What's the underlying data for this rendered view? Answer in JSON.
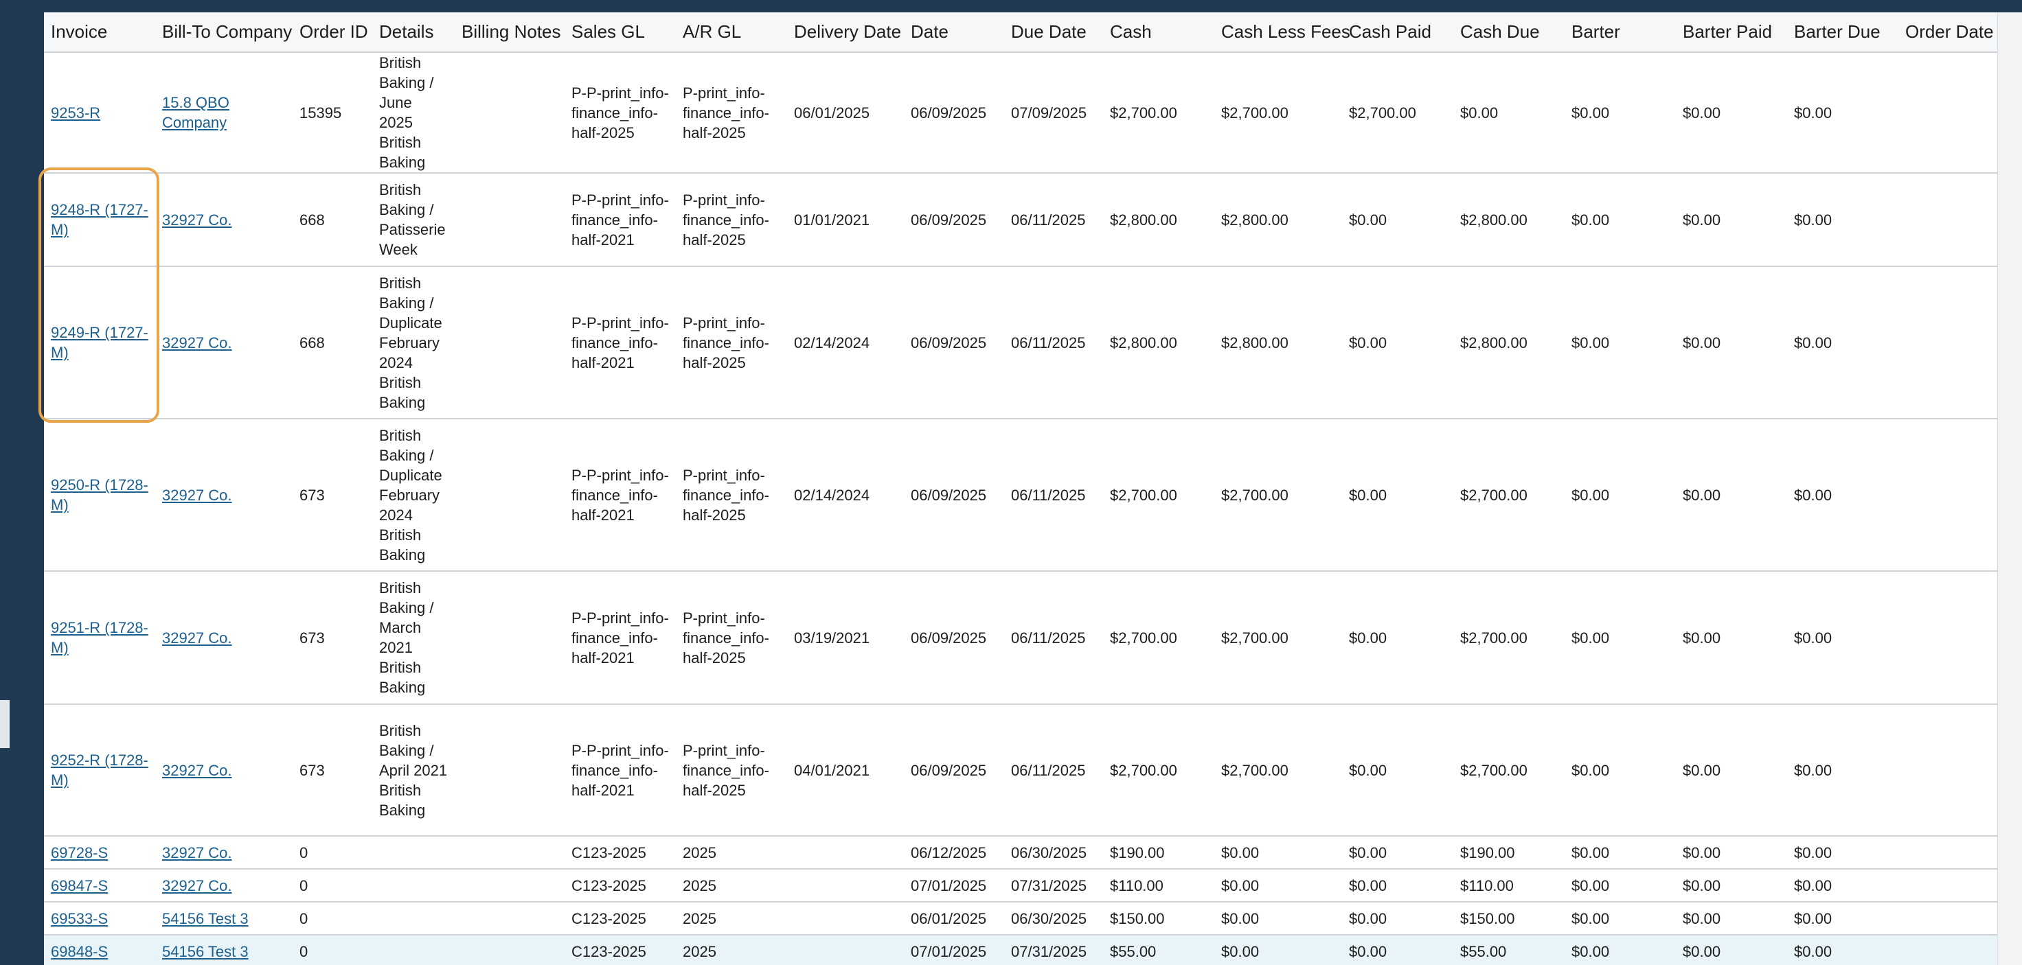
{
  "columns": [
    {
      "key": "invoice",
      "label": "Invoice"
    },
    {
      "key": "bill_to",
      "label": "Bill-To Company"
    },
    {
      "key": "order_id",
      "label": "Order ID"
    },
    {
      "key": "details",
      "label": "Details"
    },
    {
      "key": "billing_notes",
      "label": "Billing Notes"
    },
    {
      "key": "sales_gl",
      "label": "Sales GL"
    },
    {
      "key": "ar_gl",
      "label": "A/R GL"
    },
    {
      "key": "delivery_date",
      "label": "Delivery Date"
    },
    {
      "key": "date",
      "label": "Date"
    },
    {
      "key": "due_date",
      "label": "Due Date"
    },
    {
      "key": "cash",
      "label": "Cash"
    },
    {
      "key": "cash_less_fees",
      "label": "Cash Less Fees"
    },
    {
      "key": "cash_paid",
      "label": "Cash Paid"
    },
    {
      "key": "cash_due",
      "label": "Cash Due"
    },
    {
      "key": "barter",
      "label": "Barter"
    },
    {
      "key": "barter_paid",
      "label": "Barter Paid"
    },
    {
      "key": "barter_due",
      "label": "Barter Due"
    },
    {
      "key": "order_date",
      "label": "Order Date"
    }
  ],
  "rows": [
    {
      "invoice": "9253-R",
      "bill_to": "15.8 QBO Company",
      "order_id": "15395",
      "details": "British Baking / June 2025 British Baking",
      "billing_notes": "",
      "sales_gl": "P-P-print_info-finance_info-half-2025",
      "ar_gl": "P-print_info-finance_info-half-2025",
      "delivery_date": "06/01/2025",
      "date": "06/09/2025",
      "due_date": "07/09/2025",
      "cash": "$2,700.00",
      "cash_less_fees": "$2,700.00",
      "cash_paid": "$2,700.00",
      "cash_due": "$0.00",
      "barter": "$0.00",
      "barter_paid": "$0.00",
      "barter_due": "$0.00",
      "order_date": ""
    },
    {
      "invoice": "9248-R (1727-M)",
      "bill_to": "32927 Co.",
      "order_id": "668",
      "details": "British Baking / Patisserie Week",
      "billing_notes": "",
      "sales_gl": "P-P-print_info-finance_info-half-2021",
      "ar_gl": "P-print_info-finance_info-half-2025",
      "delivery_date": "01/01/2021",
      "date": "06/09/2025",
      "due_date": "06/11/2025",
      "cash": "$2,800.00",
      "cash_less_fees": "$2,800.00",
      "cash_paid": "$0.00",
      "cash_due": "$2,800.00",
      "barter": "$0.00",
      "barter_paid": "$0.00",
      "barter_due": "$0.00",
      "order_date": ""
    },
    {
      "invoice": "9249-R (1727-M)",
      "bill_to": "32927 Co.",
      "order_id": "668",
      "details": "British Baking / Duplicate February 2024 British Baking",
      "billing_notes": "",
      "sales_gl": "P-P-print_info-finance_info-half-2021",
      "ar_gl": "P-print_info-finance_info-half-2025",
      "delivery_date": "02/14/2024",
      "date": "06/09/2025",
      "due_date": "06/11/2025",
      "cash": "$2,800.00",
      "cash_less_fees": "$2,800.00",
      "cash_paid": "$0.00",
      "cash_due": "$2,800.00",
      "barter": "$0.00",
      "barter_paid": "$0.00",
      "barter_due": "$0.00",
      "order_date": ""
    },
    {
      "invoice": "9250-R (1728-M)",
      "bill_to": "32927 Co.",
      "order_id": "673",
      "details": "British Baking / Duplicate February 2024 British Baking",
      "billing_notes": "",
      "sales_gl": "P-P-print_info-finance_info-half-2021",
      "ar_gl": "P-print_info-finance_info-half-2025",
      "delivery_date": "02/14/2024",
      "date": "06/09/2025",
      "due_date": "06/11/2025",
      "cash": "$2,700.00",
      "cash_less_fees": "$2,700.00",
      "cash_paid": "$0.00",
      "cash_due": "$2,700.00",
      "barter": "$0.00",
      "barter_paid": "$0.00",
      "barter_due": "$0.00",
      "order_date": ""
    },
    {
      "invoice": "9251-R (1728-M)",
      "bill_to": "32927 Co.",
      "order_id": "673",
      "details": "British Baking / March 2021 British Baking",
      "billing_notes": "",
      "sales_gl": "P-P-print_info-finance_info-half-2021",
      "ar_gl": "P-print_info-finance_info-half-2025",
      "delivery_date": "03/19/2021",
      "date": "06/09/2025",
      "due_date": "06/11/2025",
      "cash": "$2,700.00",
      "cash_less_fees": "$2,700.00",
      "cash_paid": "$0.00",
      "cash_due": "$2,700.00",
      "barter": "$0.00",
      "barter_paid": "$0.00",
      "barter_due": "$0.00",
      "order_date": ""
    },
    {
      "invoice": "9252-R (1728-M)",
      "bill_to": "32927 Co.",
      "order_id": "673",
      "details": "British Baking / April 2021 British Baking",
      "billing_notes": "",
      "sales_gl": "P-P-print_info-finance_info-half-2021",
      "ar_gl": "P-print_info-finance_info-half-2025",
      "delivery_date": "04/01/2021",
      "date": "06/09/2025",
      "due_date": "06/11/2025",
      "cash": "$2,700.00",
      "cash_less_fees": "$2,700.00",
      "cash_paid": "$0.00",
      "cash_due": "$2,700.00",
      "barter": "$0.00",
      "barter_paid": "$0.00",
      "barter_due": "$0.00",
      "order_date": ""
    },
    {
      "invoice": "69728-S",
      "bill_to": "32927 Co.",
      "order_id": "0",
      "details": "",
      "billing_notes": "",
      "sales_gl": "C123-2025",
      "ar_gl": "2025",
      "delivery_date": "",
      "date": "06/12/2025",
      "due_date": "06/30/2025",
      "cash": "$190.00",
      "cash_less_fees": "$0.00",
      "cash_paid": "$0.00",
      "cash_due": "$190.00",
      "barter": "$0.00",
      "barter_paid": "$0.00",
      "barter_due": "$0.00",
      "order_date": ""
    },
    {
      "invoice": "69847-S",
      "bill_to": "32927 Co.",
      "order_id": "0",
      "details": "",
      "billing_notes": "",
      "sales_gl": "C123-2025",
      "ar_gl": "2025",
      "delivery_date": "",
      "date": "07/01/2025",
      "due_date": "07/31/2025",
      "cash": "$110.00",
      "cash_less_fees": "$0.00",
      "cash_paid": "$0.00",
      "cash_due": "$110.00",
      "barter": "$0.00",
      "barter_paid": "$0.00",
      "barter_due": "$0.00",
      "order_date": ""
    },
    {
      "invoice": "69533-S",
      "bill_to": "54156 Test 3",
      "order_id": "0",
      "details": "",
      "billing_notes": "",
      "sales_gl": "C123-2025",
      "ar_gl": "2025",
      "delivery_date": "",
      "date": "06/01/2025",
      "due_date": "06/30/2025",
      "cash": "$150.00",
      "cash_less_fees": "$0.00",
      "cash_paid": "$0.00",
      "cash_due": "$150.00",
      "barter": "$0.00",
      "barter_paid": "$0.00",
      "barter_due": "$0.00",
      "order_date": ""
    },
    {
      "invoice": "69848-S",
      "bill_to": "54156 Test 3",
      "order_id": "0",
      "details": "",
      "billing_notes": "",
      "sales_gl": "C123-2025",
      "ar_gl": "2025",
      "delivery_date": "",
      "date": "07/01/2025",
      "due_date": "07/31/2025",
      "cash": "$55.00",
      "cash_less_fees": "$0.00",
      "cash_paid": "$0.00",
      "cash_due": "$55.00",
      "barter": "$0.00",
      "barter_paid": "$0.00",
      "barter_due": "$0.00",
      "order_date": ""
    }
  ]
}
